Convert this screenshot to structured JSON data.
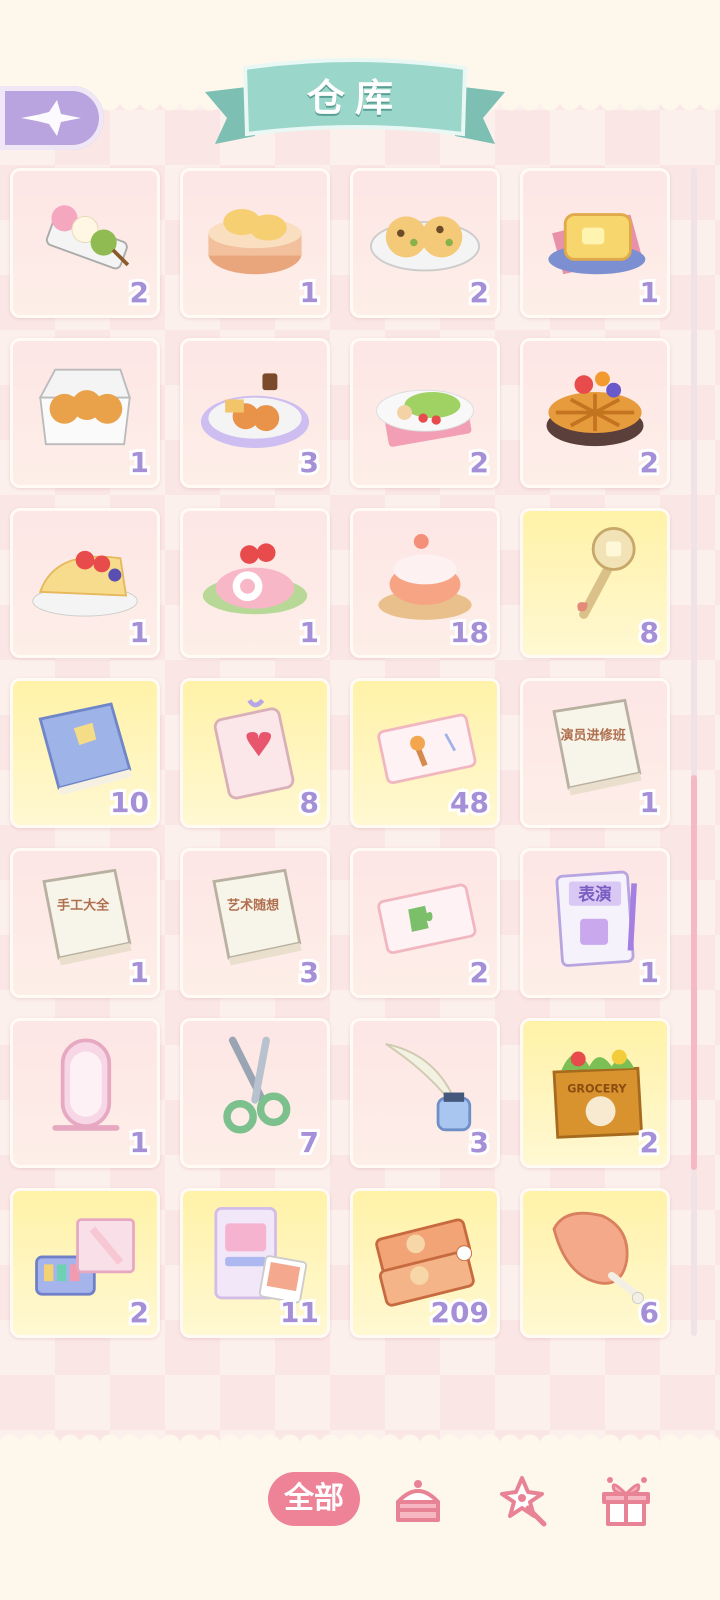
{
  "header": {
    "title": "仓库",
    "back_icon": "sparkle-arrow-back-icon"
  },
  "items": [
    {
      "name": "dango",
      "icon": "dango-icon",
      "count": "2",
      "rarity": "normal"
    },
    {
      "name": "steamed-buns",
      "icon": "steamed-bun-icon",
      "count": "1",
      "rarity": "normal"
    },
    {
      "name": "cookies",
      "icon": "cookie-plate-icon",
      "count": "2",
      "rarity": "normal"
    },
    {
      "name": "butter-toast",
      "icon": "toast-icon",
      "count": "1",
      "rarity": "normal"
    },
    {
      "name": "bread-box",
      "icon": "bread-box-icon",
      "count": "1",
      "rarity": "normal"
    },
    {
      "name": "fried-platter",
      "icon": "fried-platter-icon",
      "count": "3",
      "rarity": "normal"
    },
    {
      "name": "salad-plate",
      "icon": "salad-icon",
      "count": "2",
      "rarity": "normal"
    },
    {
      "name": "fruit-pie",
      "icon": "fruit-pie-icon",
      "count": "2",
      "rarity": "normal"
    },
    {
      "name": "fruit-crepe",
      "icon": "crepe-icon",
      "count": "1",
      "rarity": "normal"
    },
    {
      "name": "swiss-roll",
      "icon": "swiss-roll-icon",
      "count": "1",
      "rarity": "normal"
    },
    {
      "name": "cream-puff",
      "icon": "cream-puff-icon",
      "count": "18",
      "rarity": "normal"
    },
    {
      "name": "magic-wand",
      "icon": "wand-icon",
      "count": "8",
      "rarity": "gold"
    },
    {
      "name": "blue-book",
      "icon": "blue-book-icon",
      "count": "10",
      "rarity": "gold"
    },
    {
      "name": "heart-charm",
      "icon": "heart-charm-icon",
      "count": "8",
      "rarity": "gold"
    },
    {
      "name": "food-ticket",
      "icon": "ticket-icon",
      "count": "48",
      "rarity": "gold"
    },
    {
      "name": "performance-book",
      "icon": "book-icon",
      "count": "1",
      "rarity": "normal",
      "label": "演员进修班"
    },
    {
      "name": "handcraft-book",
      "icon": "book-icon",
      "count": "1",
      "rarity": "normal",
      "label": "手工大全"
    },
    {
      "name": "art-book",
      "icon": "book-icon",
      "count": "3",
      "rarity": "normal",
      "label": "艺术随想"
    },
    {
      "name": "puzzle-ticket",
      "icon": "puzzle-ticket-icon",
      "count": "2",
      "rarity": "normal"
    },
    {
      "name": "show-notebook",
      "icon": "notebook-icon",
      "count": "1",
      "rarity": "normal",
      "label": "表演"
    },
    {
      "name": "mirror",
      "icon": "mirror-icon",
      "count": "1",
      "rarity": "normal"
    },
    {
      "name": "scissors",
      "icon": "scissors-icon",
      "count": "7",
      "rarity": "normal"
    },
    {
      "name": "quill-ink",
      "icon": "quill-icon",
      "count": "3",
      "rarity": "normal"
    },
    {
      "name": "grocery-bag",
      "icon": "grocery-bag-icon",
      "count": "2",
      "rarity": "gold",
      "label": "GROCERY"
    },
    {
      "name": "art-supplies",
      "icon": "art-supplies-icon",
      "count": "2",
      "rarity": "gold"
    },
    {
      "name": "photo-cards",
      "icon": "photo-cards-icon",
      "count": "11",
      "rarity": "gold"
    },
    {
      "name": "food-coupons",
      "icon": "coupon-icon",
      "count": "209",
      "rarity": "gold"
    },
    {
      "name": "chicken-leg",
      "icon": "meat-icon",
      "count": "6",
      "rarity": "gold"
    }
  ],
  "tabs": {
    "all_label": "全部",
    "food_icon": "cake-icon",
    "tool_icon": "magic-wand-icon",
    "gift_icon": "gift-box-icon"
  },
  "colors": {
    "accent_pink": "#ee8297",
    "count_purple": "#a590d8",
    "ribbon_teal": "#8fcfc2",
    "back_purple": "#b9a4e0"
  }
}
